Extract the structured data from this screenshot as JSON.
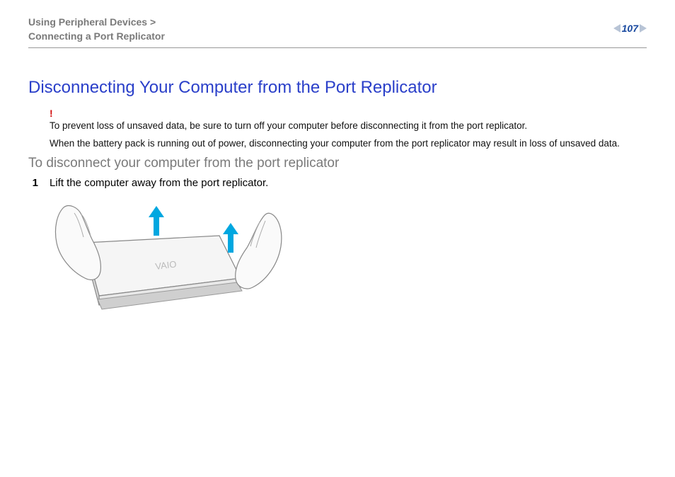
{
  "breadcrumb": {
    "line1": "Using Peripheral Devices >",
    "line2": "Connecting a Port Replicator"
  },
  "page_number": "107",
  "title": "Disconnecting Your Computer from the Port Replicator",
  "warning": {
    "bang": "!",
    "text1": "To prevent loss of unsaved data, be sure to turn off your computer before disconnecting it from the port replicator.",
    "text2": "When the battery pack is running out of power, disconnecting your computer from the port replicator may result in loss of unsaved data."
  },
  "subhead": "To disconnect your computer from the port replicator",
  "steps": [
    {
      "num": "1",
      "text": "Lift the computer away from the port replicator."
    }
  ],
  "figure": {
    "alt": "Hands lifting a VAIO laptop off a port replicator",
    "logo_text": "VAIO"
  }
}
